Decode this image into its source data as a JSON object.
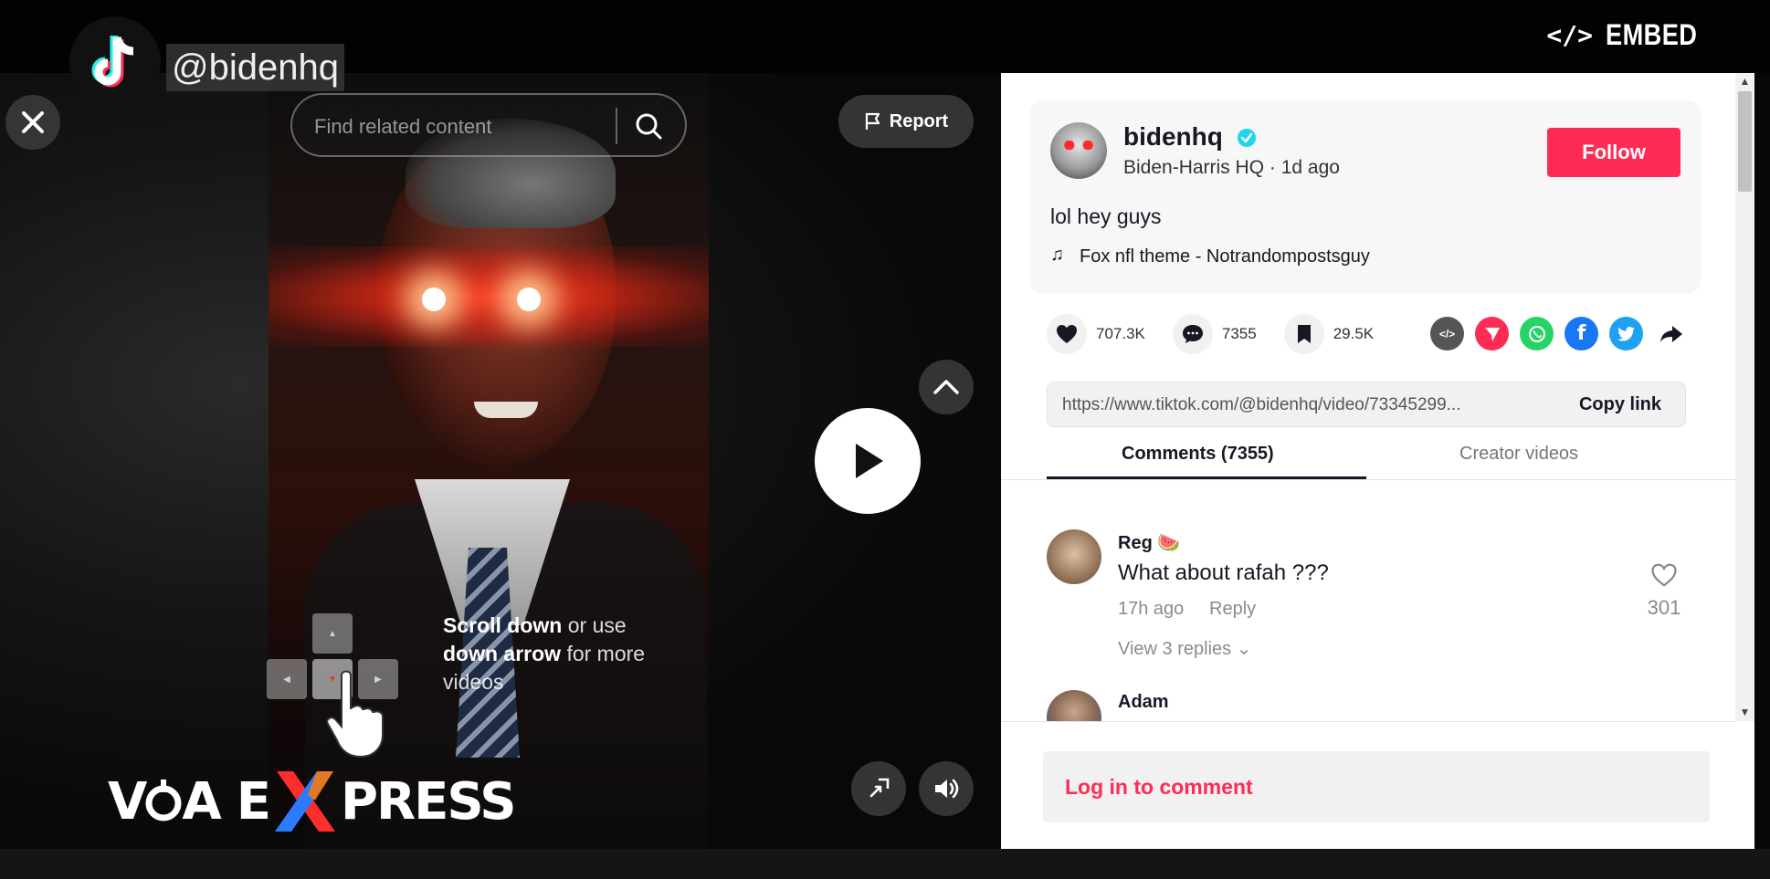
{
  "top_bar": {
    "handle": "@bidenhq",
    "embed_label": "EMBED",
    "embed_icon": "code-icon"
  },
  "video": {
    "search_placeholder": "Find related content",
    "report_label": "Report",
    "hint": {
      "scroll_bold": "Scroll down",
      "scroll_rest": " or use ",
      "arrow_bold": "down arrow",
      "arrow_rest": " for more videos"
    },
    "watermark": "VOA EXPRESS"
  },
  "post": {
    "username": "bidenhq",
    "display_name": "Biden-Harris HQ",
    "separator": " · ",
    "posted": "1d ago",
    "follow_label": "Follow",
    "caption": "lol hey guys",
    "music": "Fox nfl theme - Notrandompostsguy",
    "likes": "707.3K",
    "comments": "7355",
    "saves": "29.5K",
    "link": "https://www.tiktok.com/@bidenhq/video/73345299...",
    "copy_link_label": "Copy link"
  },
  "tabs": {
    "comments": "Comments (7355)",
    "creator": "Creator videos"
  },
  "comments": [
    {
      "user": "Reg 🍉",
      "text": "What about rafah ???",
      "time": "17h ago",
      "reply_label": "Reply",
      "replies": "View 3 replies",
      "likes": "301"
    },
    {
      "user": "Adam"
    }
  ],
  "footer": {
    "login_to_comment": "Log in to comment"
  },
  "colors": {
    "accent": "#fe2c55",
    "verified": "#20d5ec"
  }
}
